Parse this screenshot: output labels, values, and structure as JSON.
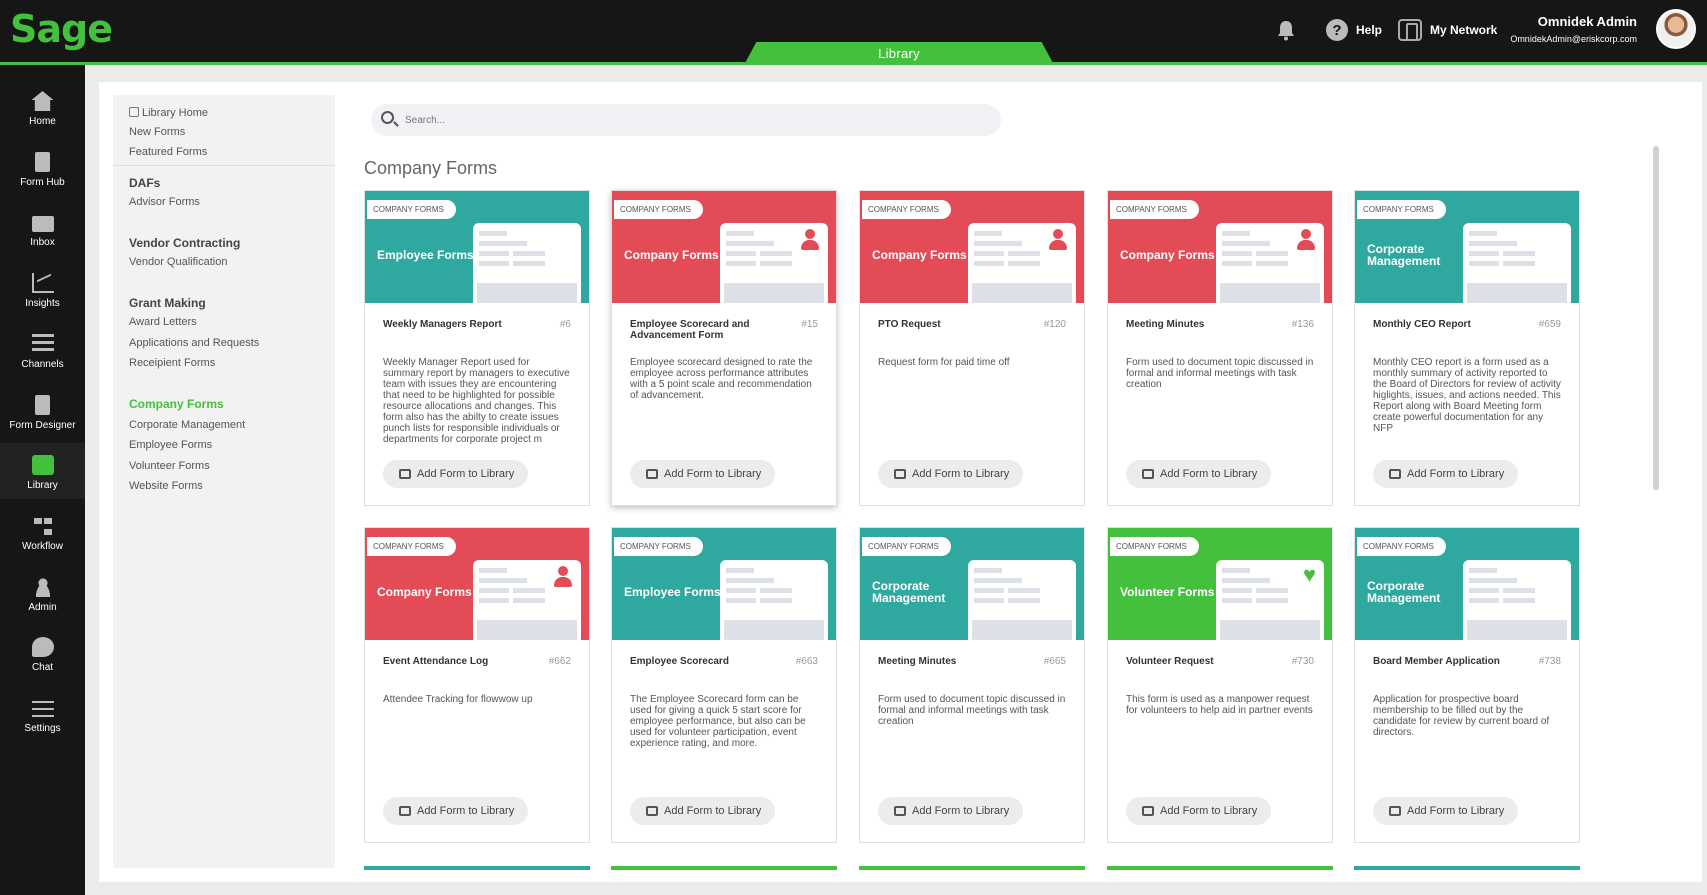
{
  "app": {
    "logo": "Sage",
    "active_tab": "Library"
  },
  "header": {
    "help": "Help",
    "network": "My Network",
    "user_name": "Omnidek Admin",
    "user_email": "OmnidekAdmin@eriskcorp.com"
  },
  "nav": [
    {
      "label": "Home",
      "icon": "home-icon"
    },
    {
      "label": "Form Hub",
      "icon": "document-icon"
    },
    {
      "label": "Inbox",
      "icon": "mail-icon"
    },
    {
      "label": "Insights",
      "icon": "chart-icon"
    },
    {
      "label": "Channels",
      "icon": "lines-icon"
    },
    {
      "label": "Form Designer",
      "icon": "pen-icon"
    },
    {
      "label": "Library",
      "icon": "store-icon",
      "active": true
    },
    {
      "label": "Workflow",
      "icon": "flow-icon"
    },
    {
      "label": "Admin",
      "icon": "people-icon"
    },
    {
      "label": "Chat",
      "icon": "chat-icon"
    },
    {
      "label": "Settings",
      "icon": "sliders-icon"
    }
  ],
  "library_nav": {
    "top": [
      "Library Home",
      "New Forms",
      "Featured Forms"
    ],
    "dafs": {
      "title": "DAFs",
      "items": [
        "Advisor Forms"
      ]
    },
    "vendor": {
      "title": "Vendor Contracting",
      "items": [
        "Vendor Qualification"
      ]
    },
    "grant": {
      "title": "Grant Making",
      "items": [
        "Award Letters",
        "Applications and Requests",
        "Receipient Forms"
      ]
    },
    "company": {
      "title": "Company Forms",
      "items": [
        "Corporate Management",
        "Employee Forms",
        "Volunteer Forms",
        "Website Forms"
      ]
    }
  },
  "search": {
    "placeholder": "Search..."
  },
  "section_title": "Company Forms",
  "add_label": "Add Form to Library",
  "colors": {
    "teal": "#2fa99f",
    "red": "#e34b57",
    "green": "#44c13c"
  },
  "cards": [
    {
      "badge": "COMPANY FORMS",
      "banner": "Employee Forms",
      "color": "teal",
      "person": false,
      "title": "Weekly Managers Report",
      "num": "#6",
      "desc": "Weekly Manager Report used for summary report by managers to executive team with issues they are encountering that need to be highlighted for possible resource allocations and changes. This form also has the abilty to create issues punch lists for responsible individuals or departments for corporate project m"
    },
    {
      "badge": "COMPANY FORMS",
      "banner": "Company Forms",
      "color": "red",
      "person": true,
      "title": "Employee Scorecard and Advancement Form",
      "num": "#15",
      "desc": "Employee scorecard designed to rate the employee across performance attributes with a 5 point scale and recommendation of advancement."
    },
    {
      "badge": "COMPANY FORMS",
      "banner": "Company Forms",
      "color": "red",
      "person": true,
      "title": "PTO Request",
      "num": "#120",
      "desc": "Request form for paid time off"
    },
    {
      "badge": "COMPANY FORMS",
      "banner": "Company Forms",
      "color": "red",
      "person": true,
      "title": "Meeting Minutes",
      "num": "#136",
      "desc": "Form used to document topic discussed in formal and informal meetings with task creation"
    },
    {
      "badge": "COMPANY FORMS",
      "banner": "Corporate Management",
      "color": "teal",
      "person": false,
      "title": "Monthly CEO Report",
      "num": "#659",
      "desc": "Monthly CEO report is a form used as a monthly summary of activity reported to the Board of Directors for review of activity higlights, issues, and actions needed. This Report along with Board Meeting form create powerful documentation for any NFP"
    },
    {
      "badge": "COMPANY FORMS",
      "banner": "Company Forms",
      "color": "red",
      "person": true,
      "title": "Event Attendance Log",
      "num": "#662",
      "desc": "Attendee Tracking for flowwow up"
    },
    {
      "badge": "COMPANY FORMS",
      "banner": "Employee Forms",
      "color": "teal",
      "person": false,
      "title": "Employee Scorecard",
      "num": "#663",
      "desc": "The Employee Scorecard form can be used for giving a quick 5 start score for employee performance, but also can be used for volunteer participation, event experience rating, and more."
    },
    {
      "badge": "COMPANY FORMS",
      "banner": "Corporate Management",
      "color": "teal",
      "person": false,
      "title": "Meeting Minutes",
      "num": "#665",
      "desc": "Form used to document topic discussed in formal and informal meetings with task creation"
    },
    {
      "badge": "COMPANY FORMS",
      "banner": "Volunteer Forms",
      "color": "green",
      "heart": true,
      "title": "Volunteer Request",
      "num": "#730",
      "desc": "This form is used as a manpower request for volunteers to help aid in partner events"
    },
    {
      "badge": "COMPANY FORMS",
      "banner": "Corporate Management",
      "color": "teal",
      "person": false,
      "title": "Board Member Application",
      "num": "#738",
      "desc": "Application for prospective board membership to be filled out by the candidate for review by current board of directors."
    }
  ],
  "next_row_colors": [
    "teal",
    "green",
    "green",
    "green",
    "teal"
  ]
}
